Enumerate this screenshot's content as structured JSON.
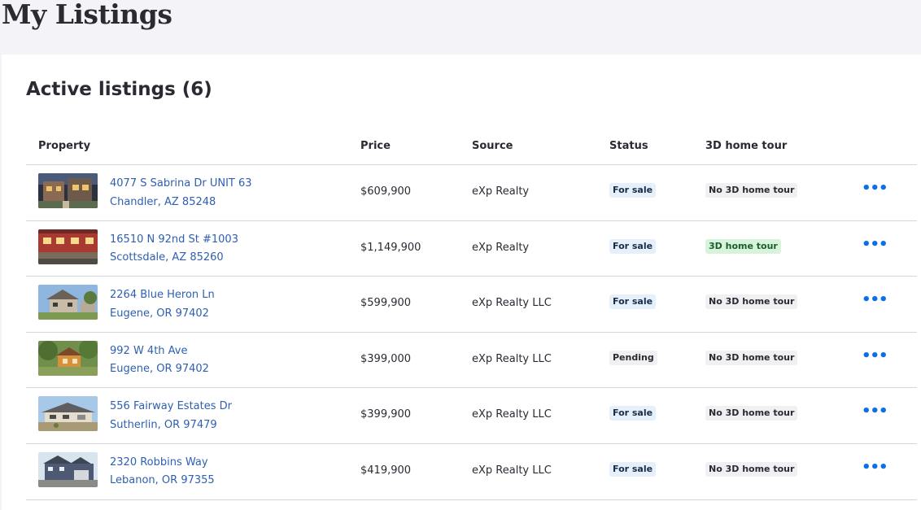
{
  "page": {
    "title": "My Listings"
  },
  "section": {
    "title": "Active listings (6)"
  },
  "table": {
    "headers": {
      "property": "Property",
      "price": "Price",
      "source": "Source",
      "status": "Status",
      "tour": "3D home tour"
    },
    "rows": [
      {
        "street": "4077 S Sabrina Dr UNIT 63",
        "city": "Chandler, AZ 85248",
        "price": "$609,900",
        "source": "eXp Realty",
        "status": "For sale",
        "tour": "No 3D home tour",
        "more": "•••"
      },
      {
        "street": "16510 N 92nd St #1003",
        "city": "Scottsdale, AZ 85260",
        "price": "$1,149,900",
        "source": "eXp Realty",
        "status": "For sale",
        "tour": "3D home tour",
        "more": "•••"
      },
      {
        "street": "2264 Blue Heron Ln",
        "city": "Eugene, OR 97402",
        "price": "$599,900",
        "source": "eXp Realty LLC",
        "status": "For sale",
        "tour": "No 3D home tour",
        "more": "•••"
      },
      {
        "street": "992 W 4th Ave",
        "city": "Eugene, OR 97402",
        "price": "$399,000",
        "source": "eXp Realty LLC",
        "status": "Pending",
        "tour": "No 3D home tour",
        "more": "•••"
      },
      {
        "street": "556 Fairway Estates Dr",
        "city": "Sutherlin, OR 97479",
        "price": "$399,900",
        "source": "eXp Realty LLC",
        "status": "For sale",
        "tour": "No 3D home tour",
        "more": "•••"
      },
      {
        "street": "2320 Robbins Way",
        "city": "Lebanon, OR 97355",
        "price": "$419,900",
        "source": "eXp Realty LLC",
        "status": "For sale",
        "tour": "No 3D home tour",
        "more": "•••"
      }
    ]
  },
  "colors": {
    "link": "#2e5fb0",
    "accent": "#0b6fe8",
    "for_sale_bg": "#e6f0fa",
    "tour_yes_bg": "#d8f3dc",
    "neutral_badge_bg": "#f0f0f2"
  },
  "icons": {
    "more": "more-options-icon"
  }
}
